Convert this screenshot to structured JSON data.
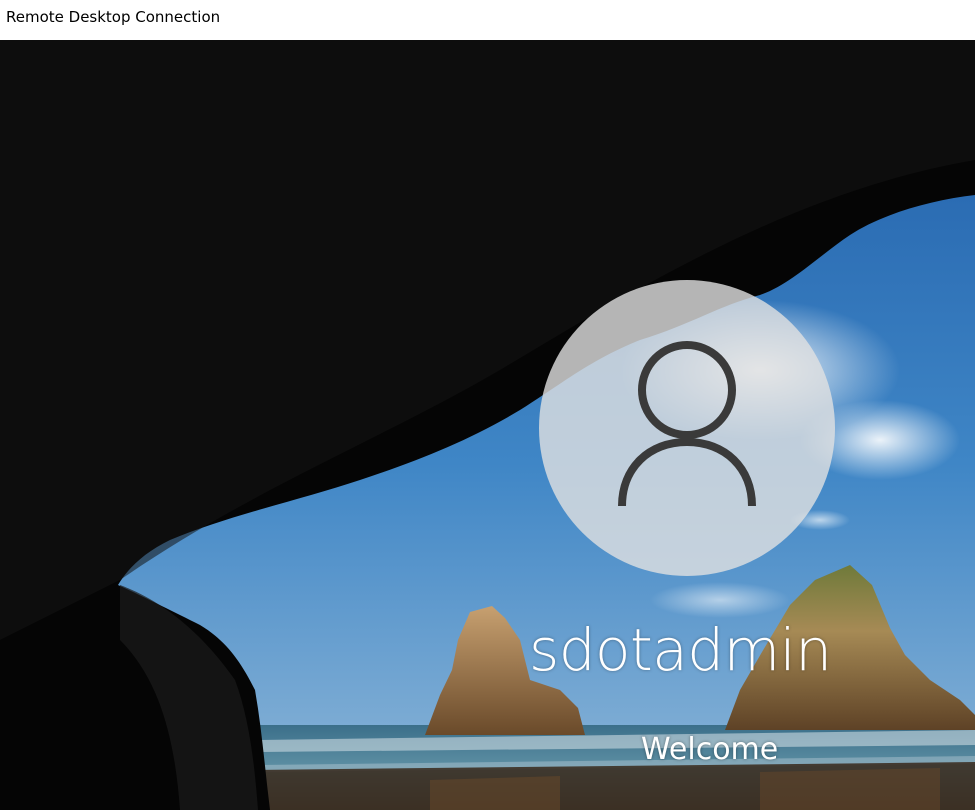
{
  "window": {
    "title": "Remote Desktop Connection"
  },
  "lock_screen": {
    "user_name": "sdotadmin",
    "status": "Welcome",
    "avatar_icon": "user-icon"
  },
  "colors": {
    "title_bg": "#ffffff",
    "title_text": "#000000",
    "text": "#ffffff",
    "avatar_bg": "#e1e1e1",
    "avatar_glyph": "#3a3a3a"
  }
}
